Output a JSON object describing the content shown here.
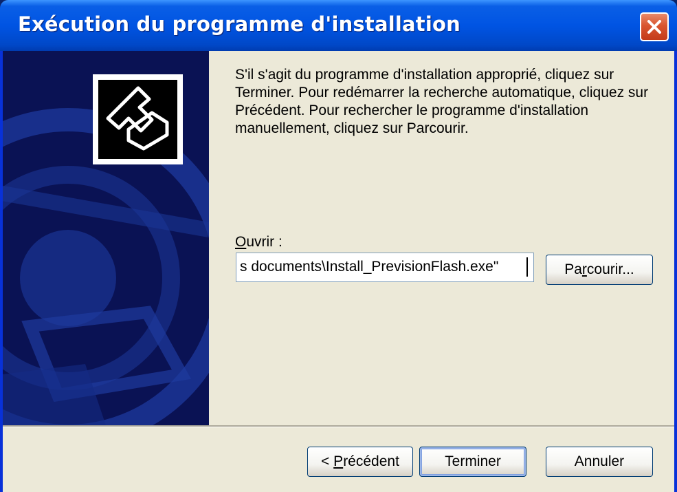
{
  "window": {
    "title": "Exécution du programme d'installation",
    "icons": {
      "close": "close-icon",
      "logo": "setup-arrow-icon"
    },
    "colors": {
      "titlebar": "#0054E3",
      "sidebar": "#0A1254",
      "close": "#D9552F"
    }
  },
  "main": {
    "instructions": "S'il s'agit du programme d'installation approprié, cliquez sur Terminer. Pour redémarrer la recherche automatique, cliquez sur Précédent. Pour rechercher le programme d'installation manuellement, cliquez sur Parcourir.",
    "open_label": {
      "mnemonic": "O",
      "rest": "uvrir :"
    },
    "open_value": "s documents\\Install_PrevisionFlash.exe\"",
    "browse_button": {
      "before": "Pa",
      "mnemonic": "r",
      "after": "courir..."
    }
  },
  "footer": {
    "back_button": {
      "before": "< ",
      "mnemonic": "P",
      "after": "récédent"
    },
    "finish_label": "Terminer",
    "cancel_label": "Annuler"
  }
}
